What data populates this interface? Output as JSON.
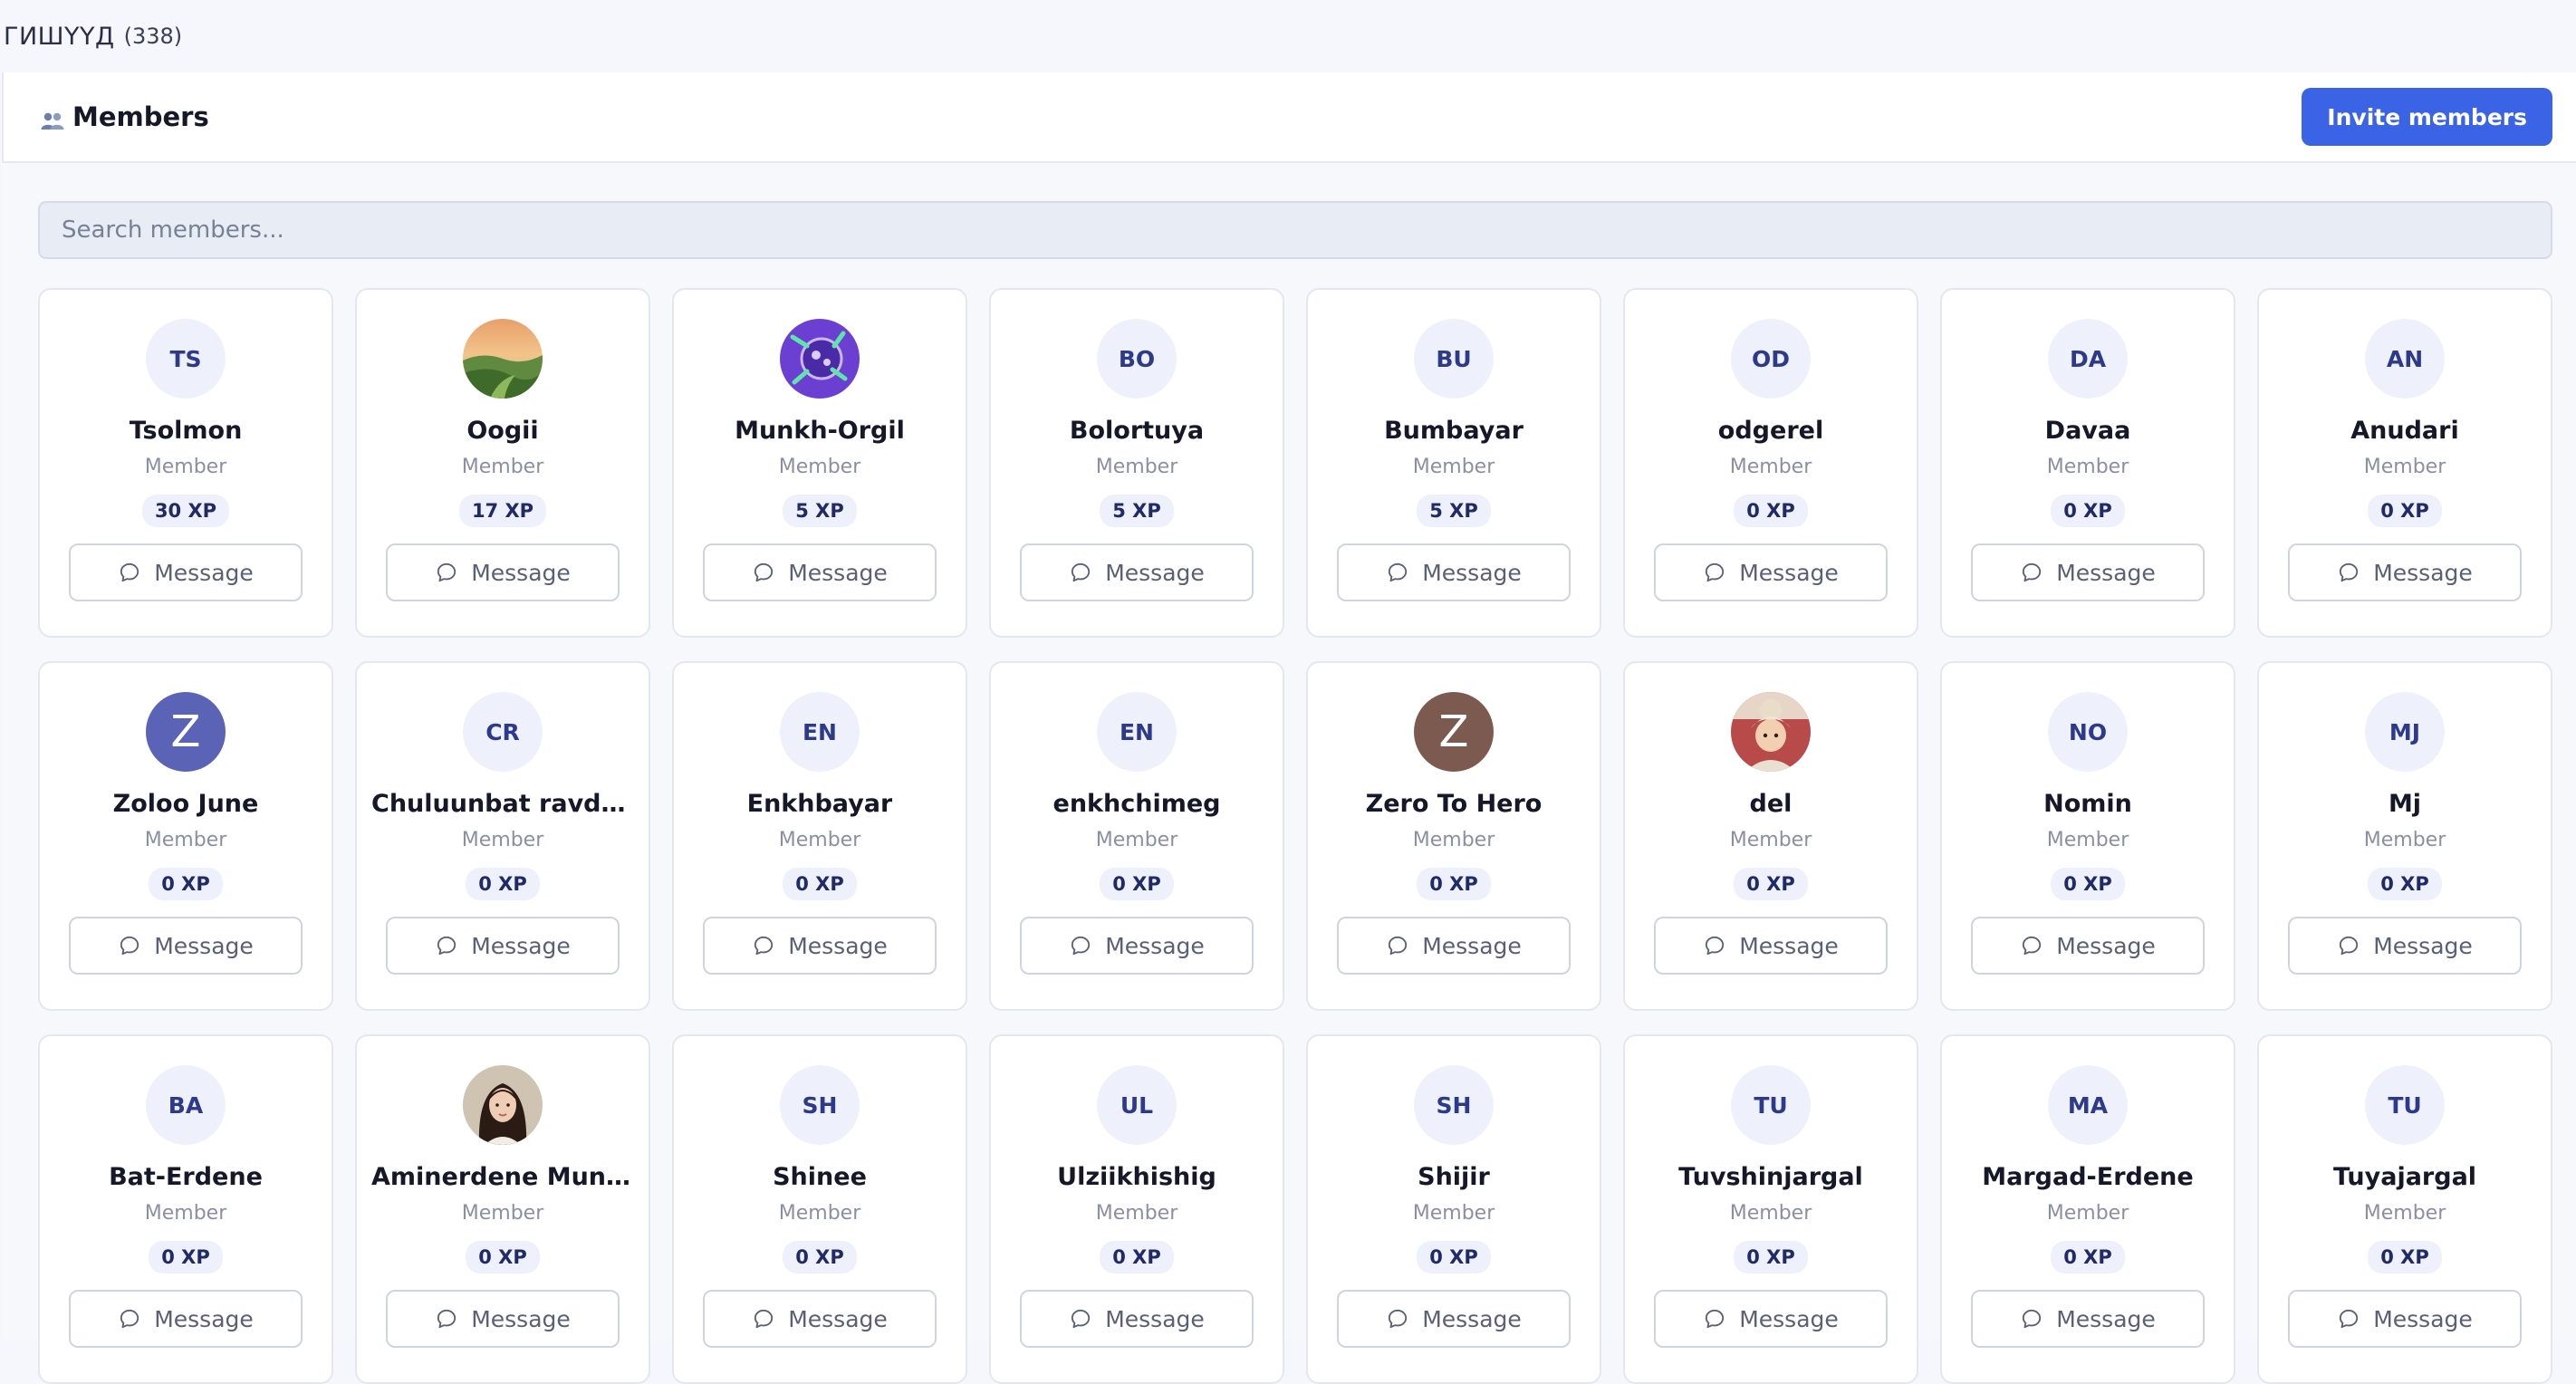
{
  "header": {
    "title": "ГИШҮҮД",
    "count": "(338)"
  },
  "panel": {
    "title": "Members",
    "icon": "people-icon",
    "invite_label": "Invite members",
    "search_placeholder": "Search members..."
  },
  "colors": {
    "accent": "#3b63e6",
    "chip_bg": "#eef1fb",
    "chip_text": "#1f2a66"
  },
  "message_label": "Message",
  "members": [
    {
      "name": "Tsolmon",
      "role": "Member",
      "xp": "30 XP",
      "initials": "TS",
      "avatar": "initials"
    },
    {
      "name": "Oogii",
      "role": "Member",
      "xp": "17 XP",
      "initials": "",
      "avatar": "landscape-photo"
    },
    {
      "name": "Munkh-Orgil",
      "role": "Member",
      "xp": "5 XP",
      "initials": "",
      "avatar": "purple-art"
    },
    {
      "name": "Bolortuya",
      "role": "Member",
      "xp": "5 XP",
      "initials": "BO",
      "avatar": "initials"
    },
    {
      "name": "Bumbayar",
      "role": "Member",
      "xp": "5 XP",
      "initials": "BU",
      "avatar": "initials"
    },
    {
      "name": "odgerel",
      "role": "Member",
      "xp": "0 XP",
      "initials": "OD",
      "avatar": "initials"
    },
    {
      "name": "Davaa",
      "role": "Member",
      "xp": "0 XP",
      "initials": "DA",
      "avatar": "initials"
    },
    {
      "name": "Anudari",
      "role": "Member",
      "xp": "0 XP",
      "initials": "AN",
      "avatar": "initials"
    },
    {
      "name": "Zoloo June",
      "role": "Member",
      "xp": "0 XP",
      "initials": "Z",
      "avatar": "letter",
      "color": "#5b63b7"
    },
    {
      "name": "Chuluunbat ravdan",
      "role": "Member",
      "xp": "0 XP",
      "initials": "CR",
      "avatar": "initials"
    },
    {
      "name": "Enkhbayar",
      "role": "Member",
      "xp": "0 XP",
      "initials": "EN",
      "avatar": "initials"
    },
    {
      "name": "enkhchimeg",
      "role": "Member",
      "xp": "0 XP",
      "initials": "EN",
      "avatar": "initials"
    },
    {
      "name": "Zero To Hero",
      "role": "Member",
      "xp": "0 XP",
      "initials": "Z",
      "avatar": "letter",
      "color": "#7d5a50"
    },
    {
      "name": "del",
      "role": "Member",
      "xp": "0 XP",
      "initials": "",
      "avatar": "child-photo"
    },
    {
      "name": "Nomin",
      "role": "Member",
      "xp": "0 XP",
      "initials": "NO",
      "avatar": "initials"
    },
    {
      "name": "Mj",
      "role": "Member",
      "xp": "0 XP",
      "initials": "MJ",
      "avatar": "initials"
    },
    {
      "name": "Bat-Erdene",
      "role": "Member",
      "xp": "0 XP",
      "initials": "BA",
      "avatar": "initials"
    },
    {
      "name": "Aminerdene Munkhbaatar",
      "role": "Member",
      "xp": "0 XP",
      "initials": "",
      "avatar": "woman-photo"
    },
    {
      "name": "Shinee",
      "role": "Member",
      "xp": "0 XP",
      "initials": "SH",
      "avatar": "initials"
    },
    {
      "name": "Ulziikhishig",
      "role": "Member",
      "xp": "0 XP",
      "initials": "UL",
      "avatar": "initials"
    },
    {
      "name": "Shijir",
      "role": "Member",
      "xp": "0 XP",
      "initials": "SH",
      "avatar": "initials"
    },
    {
      "name": "Tuvshinjargal",
      "role": "Member",
      "xp": "0 XP",
      "initials": "TU",
      "avatar": "initials"
    },
    {
      "name": "Margad-Erdene",
      "role": "Member",
      "xp": "0 XP",
      "initials": "MA",
      "avatar": "initials"
    },
    {
      "name": "Tuyajargal",
      "role": "Member",
      "xp": "0 XP",
      "initials": "TU",
      "avatar": "initials"
    }
  ]
}
